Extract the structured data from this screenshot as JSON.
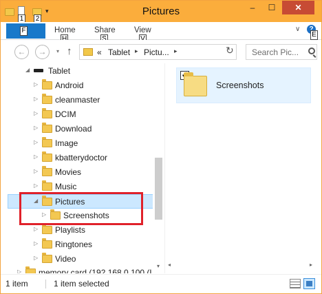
{
  "window": {
    "title": "Pictures",
    "controls": {
      "minimize": "–",
      "maximize": "☐",
      "close": "✕"
    }
  },
  "quick_access": {
    "keytips": [
      "1",
      "2"
    ],
    "dropdown": "▾"
  },
  "ribbon": {
    "file_keytip": "F",
    "tabs": [
      {
        "label": "Home",
        "keytip": "H"
      },
      {
        "label": "Share",
        "keytip": "S"
      },
      {
        "label": "View",
        "keytip": "V"
      }
    ],
    "help_keytip": "E",
    "help_label": "?",
    "chevron": "∨"
  },
  "address": {
    "back": "←",
    "forward": "→",
    "history_dropdown": "▾",
    "up": "↑",
    "overflow": "«",
    "crumbs": [
      "Tablet",
      "Pictu..."
    ],
    "separator": "▸",
    "dropdown": "▾",
    "refresh": "↻",
    "search_placeholder": "Search Pic..."
  },
  "nav_tree": [
    {
      "label": "Tablet",
      "expander": "◢",
      "icon": "device-icon",
      "indent": 0,
      "expanded": true
    },
    {
      "label": "Android",
      "expander": "▷",
      "indent": 1
    },
    {
      "label": "cleanmaster",
      "expander": "▷",
      "indent": 1
    },
    {
      "label": "DCIM",
      "expander": "▷",
      "indent": 1
    },
    {
      "label": "Download",
      "expander": "▷",
      "indent": 1
    },
    {
      "label": "Image",
      "expander": "▷",
      "indent": 1
    },
    {
      "label": "kbatterydoctor",
      "expander": "▷",
      "indent": 1
    },
    {
      "label": "Movies",
      "expander": "▷",
      "indent": 1
    },
    {
      "label": "Music",
      "expander": "▷",
      "indent": 1
    },
    {
      "label": "Pictures",
      "expander": "◢",
      "indent": 1,
      "selected": true,
      "expanded": true
    },
    {
      "label": "Screenshots",
      "expander": "▷",
      "indent": 2
    },
    {
      "label": "Playlists",
      "expander": "▷",
      "indent": 1
    },
    {
      "label": "Ringtones",
      "expander": "▷",
      "indent": 1
    },
    {
      "label": "Video",
      "expander": "▷",
      "indent": 1
    },
    {
      "label": "memory card (192.168.0.100 (L",
      "expander": "▷",
      "indent": 0
    }
  ],
  "scrollbars": {
    "up": "▴",
    "down": "▾",
    "left": "◂",
    "right": "▸"
  },
  "content": {
    "items": [
      {
        "label": "Screenshots",
        "checked": true,
        "check_glyph": "✓"
      }
    ]
  },
  "status": {
    "item_count": "1 item",
    "selection": "1 item selected"
  },
  "colors": {
    "titlebar": "#fbad3c",
    "file_tab": "#1979ca",
    "selection": "#cce8ff",
    "highlight_box": "#e0212a"
  }
}
